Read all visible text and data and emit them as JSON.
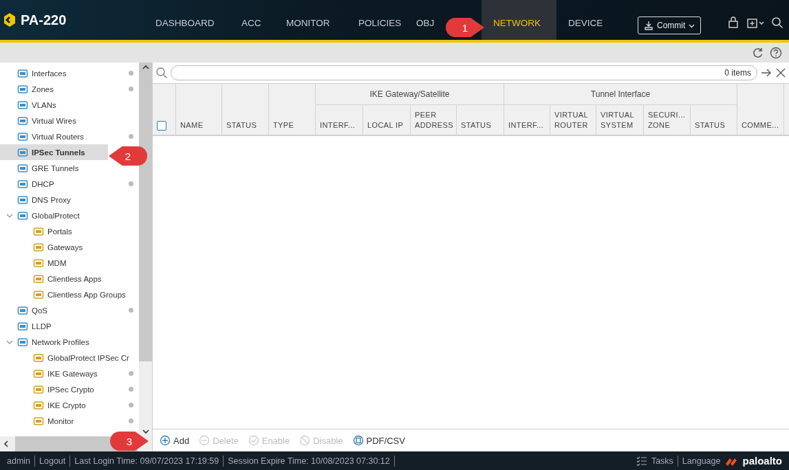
{
  "header": {
    "logo": "PA-220",
    "tabs": [
      {
        "label": "DASHBOARD",
        "selected": false
      },
      {
        "label": "ACC",
        "selected": false
      },
      {
        "label": "MONITOR",
        "selected": false
      },
      {
        "label": "POLICIES",
        "selected": false
      },
      {
        "label": "OBJ",
        "selected": false
      },
      {
        "label": "NETWORK",
        "selected": true
      },
      {
        "label": "DEVICE",
        "selected": false
      }
    ],
    "commit": "Commit"
  },
  "sidebar": {
    "items": [
      {
        "label": "Interfaces",
        "selected": false,
        "dot": true
      },
      {
        "label": "Zones",
        "selected": false,
        "dot": true
      },
      {
        "label": "VLANs",
        "selected": false,
        "dot": false
      },
      {
        "label": "Virtual Wires",
        "selected": false,
        "dot": false
      },
      {
        "label": "Virtual Routers",
        "selected": false,
        "dot": true
      },
      {
        "label": "IPSec Tunnels",
        "selected": true,
        "dot": false
      },
      {
        "label": "GRE Tunnels",
        "selected": false,
        "dot": false
      },
      {
        "label": "DHCP",
        "selected": false,
        "dot": true
      },
      {
        "label": "DNS Proxy",
        "selected": false,
        "dot": false
      },
      {
        "label": "GlobalProtect",
        "selected": false,
        "dot": false,
        "expanded": true,
        "children": [
          {
            "label": "Portals",
            "selected": false,
            "dot": false
          },
          {
            "label": "Gateways",
            "selected": false,
            "dot": false
          },
          {
            "label": "MDM",
            "selected": false,
            "dot": false
          },
          {
            "label": "Clientless Apps",
            "selected": false,
            "dot": false
          },
          {
            "label": "Clientless App Groups",
            "selected": false,
            "dot": false
          }
        ]
      },
      {
        "label": "QoS",
        "selected": false,
        "dot": true
      },
      {
        "label": "LLDP",
        "selected": false,
        "dot": false
      },
      {
        "label": "Network Profiles",
        "selected": false,
        "dot": false,
        "expanded": true,
        "children": [
          {
            "label": "GlobalProtect IPSec Cr",
            "selected": false,
            "dot": false
          },
          {
            "label": "IKE Gateways",
            "selected": false,
            "dot": true
          },
          {
            "label": "IPSec Crypto",
            "selected": false,
            "dot": true
          },
          {
            "label": "IKE Crypto",
            "selected": false,
            "dot": true
          },
          {
            "label": "Monitor",
            "selected": false,
            "dot": true
          }
        ]
      }
    ]
  },
  "search": {
    "count": "0 items"
  },
  "table": {
    "groups": [
      {
        "label": "IKE Gateway/Satellite"
      },
      {
        "label": "Tunnel Interface"
      }
    ],
    "columns": [
      [
        "NAME"
      ],
      [
        "STATUS"
      ],
      [
        "TYPE"
      ],
      [
        "INTERF..."
      ],
      [
        "LOCAL IP"
      ],
      [
        "PEER",
        "ADDRESS"
      ],
      [
        "STATUS"
      ],
      [
        "INTERF..."
      ],
      [
        "VIRTUAL",
        "ROUTER"
      ],
      [
        "VIRTUAL",
        "SYSTEM"
      ],
      [
        "SECURI...",
        "ZONE"
      ],
      [
        "STATUS"
      ],
      [
        "COMME..."
      ]
    ],
    "select_all": false
  },
  "actions": [
    {
      "kind": "add",
      "label": "Add",
      "disabled": false
    },
    {
      "kind": "delete",
      "label": "Delete",
      "disabled": true
    },
    {
      "kind": "enable",
      "label": "Enable",
      "disabled": true
    },
    {
      "kind": "disable",
      "label": "Disable",
      "disabled": true
    },
    {
      "kind": "pdf",
      "label": "PDF/CSV",
      "disabled": false
    }
  ],
  "status_bar": {
    "left": [
      "admin",
      "Logout",
      "Last Login Time: 09/07/2023 17:19:59",
      "Session Expire Time: 10/08/2023 07:30:12"
    ],
    "tasks": "Tasks",
    "language": "Language",
    "brand": "paloalto"
  },
  "callouts": [
    "1",
    "2",
    "3"
  ]
}
